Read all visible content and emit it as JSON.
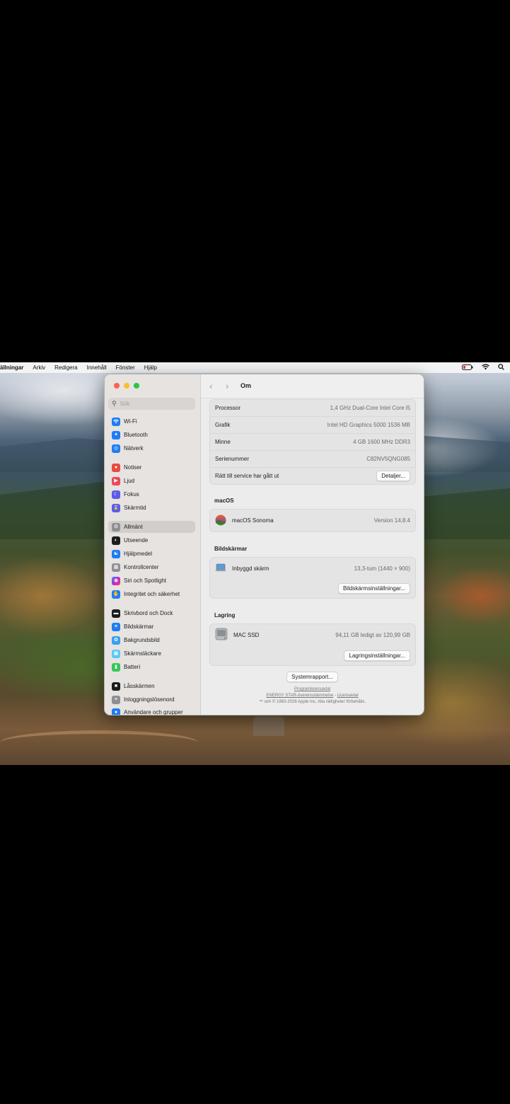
{
  "menubar": {
    "app": "ällningar",
    "items": [
      "Arkiv",
      "Redigera",
      "Innehåll",
      "Fönster",
      "Hjälp"
    ],
    "right_icons": [
      "battery-icon",
      "wifi-icon",
      "search-icon"
    ]
  },
  "sidebar": {
    "search_placeholder": "Sök",
    "items": [
      {
        "label": "Wi-Fi",
        "icon": "wifi-icon",
        "color": "#1f7cf5"
      },
      {
        "label": "Bluetooth",
        "icon": "bluetooth-icon",
        "color": "#1f7cf5"
      },
      {
        "label": "Nätverk",
        "icon": "globe-icon",
        "color": "#1f7cf5"
      },
      {
        "label": "Notiser",
        "icon": "bell-icon",
        "color": "#ea4a3f"
      },
      {
        "label": "Ljud",
        "icon": "speaker-icon",
        "color": "#ea4a5a"
      },
      {
        "label": "Fokus",
        "icon": "moon-icon",
        "color": "#5e5ce6"
      },
      {
        "label": "Skärmtid",
        "icon": "hourglass-icon",
        "color": "#5e5ce6"
      },
      {
        "label": "Allmänt",
        "icon": "gear-icon",
        "color": "#8e8e93",
        "selected": true
      },
      {
        "label": "Utseende",
        "icon": "appearance-icon",
        "color": "#1c1c1e"
      },
      {
        "label": "Hjälpmedel",
        "icon": "accessibility-icon",
        "color": "#1f7cf5"
      },
      {
        "label": "Kontrollcenter",
        "icon": "control-center-icon",
        "color": "#8e8e93"
      },
      {
        "label": "Siri och Spotlight",
        "icon": "siri-icon",
        "color": "#6e3fd1"
      },
      {
        "label": "Integritet och säkerhet",
        "icon": "hand-icon",
        "color": "#1f7cf5"
      },
      {
        "label": "Skrivbord och Dock",
        "icon": "dock-icon",
        "color": "#1c1c1e"
      },
      {
        "label": "Bildskärmar",
        "icon": "sun-icon",
        "color": "#1f7cf5"
      },
      {
        "label": "Bakgrundsbild",
        "icon": "flower-icon",
        "color": "#39a0f0"
      },
      {
        "label": "Skärmsläckare",
        "icon": "screensaver-icon",
        "color": "#5ac8fa"
      },
      {
        "label": "Batteri",
        "icon": "battery-icon",
        "color": "#34c759"
      },
      {
        "label": "Låsskärmen",
        "icon": "lock-icon",
        "color": "#1c1c1e"
      },
      {
        "label": "Inloggningslösenord",
        "icon": "key-icon",
        "color": "#8e8e93"
      },
      {
        "label": "Användare och grupper",
        "icon": "users-icon",
        "color": "#1f7cf5"
      }
    ]
  },
  "toolbar": {
    "title": "Om"
  },
  "specs": [
    {
      "label": "Processor",
      "value": "1,4 GHz Dual-Core Intel Core i5"
    },
    {
      "label": "Grafik",
      "value": "Intel HD Graphics 5000 1536 MB"
    },
    {
      "label": "Minne",
      "value": "4 GB 1600 MHz DDR3"
    },
    {
      "label": "Serienummer",
      "value": "C82NV5QNG085"
    },
    {
      "label": "Rätt till service har gått ut",
      "button": "Detaljer..."
    }
  ],
  "macos": {
    "heading": "macOS",
    "name": "macOS Sonoma",
    "version": "Version 14.8.4"
  },
  "displays": {
    "heading": "Bildskärmar",
    "name": "Inbyggd skärm",
    "value": "13,3-tum (1440 × 900)",
    "button": "Bildskärmsinställningar..."
  },
  "storage": {
    "heading": "Lagring",
    "name": "MAC SSD",
    "value": "94,11 GB ledigt av 120,99 GB",
    "button": "Lagringsinställningar..."
  },
  "footer": {
    "report_button": "Systemrapport...",
    "license_link": "Programlicensavtal",
    "energy_link": "ENERGY STAR-överensstämmelse",
    "separator": "-",
    "license2_link": "Licensavtal",
    "copyright": "™ och © 1983-2026 Apple Inc. Alla rättigheter förbehålls."
  }
}
